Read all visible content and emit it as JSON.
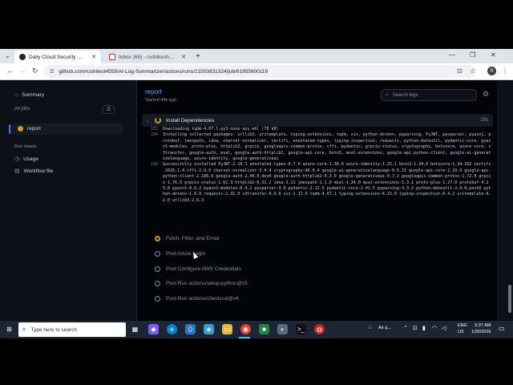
{
  "browser": {
    "tabs": [
      {
        "title": "Daily Cloud Security Monitor · ...",
        "active": true
      },
      {
        "title": "Inbox (69) - rushikeshnikam.w...",
        "active": false
      }
    ],
    "new_tab": "+",
    "url": "github.com/rushitest4559/AI-Log-Summarizer/actions/runs/21503831324/job/61955600119",
    "window_controls": [
      "⌄",
      "—",
      "❐",
      "✕"
    ],
    "profile_initial": "R"
  },
  "sidebar": {
    "summary_label": "Summary",
    "all_jobs_label": "All jobs",
    "active_job": "report",
    "run_details_label": "Run details",
    "usage_label": "Usage",
    "workflow_file_label": "Workflow file"
  },
  "job": {
    "title": "report",
    "started": "Started 44s ago",
    "search_placeholder": "Search logs"
  },
  "current_step": {
    "name": "Install Dependencies",
    "duration": "15s"
  },
  "log_lines": [
    {
      "n": "183",
      "t": "Downloading tqdm-4.67.1-py3-none-any.whl (78 kB)"
    },
    {
      "n": "184",
      "t": "Installing collected packages: urllib3, uritemplate, typing-extensions, tqdm, six, python-dotenv, pyparsing, PyJWT, pycparser, pyasn1, protobuf, jmespath, idna, charset-normalizer, certifi, annotated-types, typing-inspection, requests, python-dateutil, pydantic-core, pyasn1-modules, proto-plus, httplib2, grpcio, googleapis-common-protos, cffi, pydantic, grpcio-status, cryptography, botocore, azure-core, s3transfer, google-auth, msal, google-auth-httplib2, google-api-core, boto3, msal-extensions, google-api-python-client, google-ai-generativelanguage, azure-identity, google-generativeai"
    },
    {
      "n": "186",
      "t": "Successfully installed PyJWT-2.10.1 annotated-types-0.7.0 azure-core-1.38.0 azure-identity-1.25.1 boto3-1.34.0 botocore-1.34.162 certifi-2026.1.4 cffi-2.0.0 charset-normalizer-3.4.4 cryptography-46.0.4 google-ai-generativelanguage-0.6.15 google-api-core-2.29.0 google-api-python-client-2.188.0 google-auth-2.49.0.dev0 google-auth-httplib2-0.3.0 google-generativeai-0.7.2 googleapis-common-protos-1.72.0 grpcio-1.76.0 grpcio-status-1.62.3 httplib2-0.31.2 idna-3.11 jmespath-1.1.0 msal-1.34.0 msal-extensions-1.3.1 proto-plus-1.27.0 protobuf-4.25.8 pyasn1-0.6.2 pyasn1-modules-0.4.2 pycparser-3.0 pydantic-2.12.5 pydantic-core-2.41.5 pyparsing-3.3.2 python-dateutil-2.9.0.post0 python-dotenv-1.0.0 requests-2.31.0 s3transfer-0.9.0 six-1.17.0 tqdm-4.67.1 typing-extensions-4.15.0 typing-inspection-0.4.2 uritemplate-4.2.0 urllib3-2.6.3"
    }
  ],
  "steps": [
    {
      "name": "Fetch, Filter, and Email",
      "state": "queued"
    },
    {
      "name": "Post Azure Login",
      "state": "pending"
    },
    {
      "name": "Post Configure AWS Credentials",
      "state": "pending"
    },
    {
      "name": "Post Run actions/setup-python@v5",
      "state": "pending"
    },
    {
      "name": "Post Run actions/checkout@v4",
      "state": "pending"
    }
  ],
  "taskbar": {
    "search_placeholder": "Type here to search",
    "weather": "Air q...",
    "lang": "ENG",
    "region": "US",
    "time": "9:27 AM",
    "date": "1/30/2026"
  },
  "colors": {
    "accent": "#58a6ff",
    "in_progress": "#d29922",
    "page_bg": "#0d1117"
  }
}
